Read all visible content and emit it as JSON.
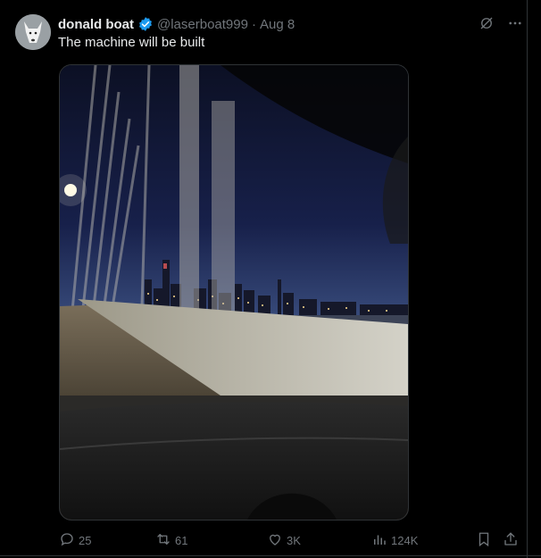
{
  "tweet": {
    "author_name": "donald boat",
    "handle": "@laserboat999",
    "separator": "·",
    "date": "Aug 8",
    "text": "The machine will be built",
    "verified": true
  },
  "actions": {
    "replies": "25",
    "reposts": "61",
    "likes": "3K",
    "views": "124K"
  },
  "icons": [
    "grok-icon",
    "more-icon",
    "reply-icon",
    "repost-icon",
    "like-icon",
    "views-icon",
    "bookmark-icon",
    "share-icon"
  ],
  "colors": {
    "background": "#000000",
    "text": "#e7e9ea",
    "secondary": "#71767b",
    "verified": "#1d9bf0"
  }
}
